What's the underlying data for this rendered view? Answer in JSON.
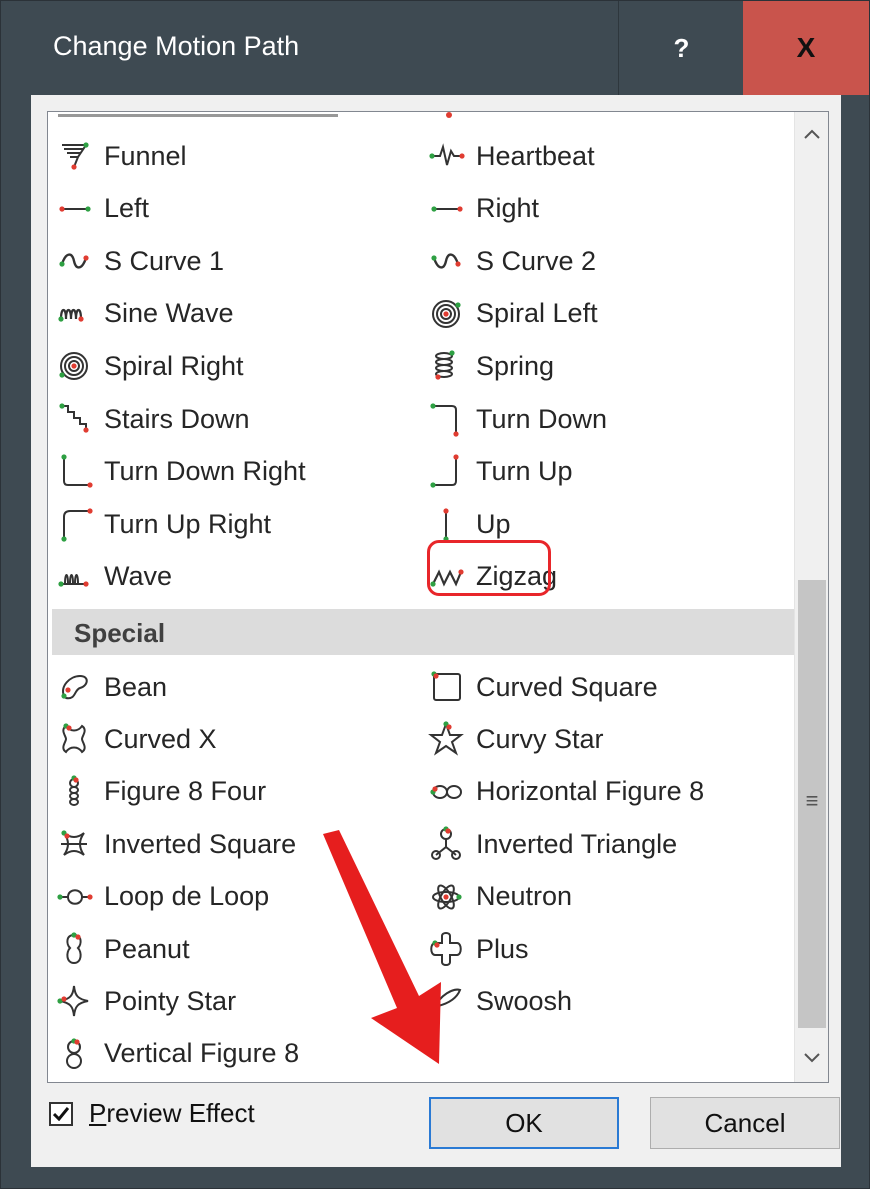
{
  "dialog": {
    "title": "Change Motion Path",
    "help_label": "?",
    "close_label": "X"
  },
  "list": {
    "column_left": [
      {
        "label": "Funnel",
        "icon": "funnel-icon"
      },
      {
        "label": "Left",
        "icon": "line-left-icon"
      },
      {
        "label": "S Curve 1",
        "icon": "s-curve-1-icon"
      },
      {
        "label": "Sine Wave",
        "icon": "sine-wave-icon"
      },
      {
        "label": "Spiral Right",
        "icon": "spiral-right-icon"
      },
      {
        "label": "Stairs Down",
        "icon": "stairs-down-icon"
      },
      {
        "label": "Turn Down Right",
        "icon": "turn-down-right-icon"
      },
      {
        "label": "Turn Up Right",
        "icon": "turn-up-right-icon"
      },
      {
        "label": "Wave",
        "icon": "wave-icon"
      }
    ],
    "column_right": [
      {
        "label": "Heartbeat",
        "icon": "heartbeat-icon"
      },
      {
        "label": "Right",
        "icon": "line-right-icon"
      },
      {
        "label": "S Curve 2",
        "icon": "s-curve-2-icon"
      },
      {
        "label": "Spiral Left",
        "icon": "spiral-left-icon"
      },
      {
        "label": "Spring",
        "icon": "spring-icon"
      },
      {
        "label": "Turn Down",
        "icon": "turn-down-icon"
      },
      {
        "label": "Turn Up",
        "icon": "turn-up-icon"
      },
      {
        "label": "Up",
        "icon": "line-up-icon"
      },
      {
        "label": "Zigzag",
        "icon": "zigzag-icon"
      }
    ],
    "special_header": "Special",
    "special_left": [
      {
        "label": "Bean",
        "icon": "bean-icon"
      },
      {
        "label": "Curved X",
        "icon": "curved-x-icon"
      },
      {
        "label": "Figure 8 Four",
        "icon": "figure-8-four-icon"
      },
      {
        "label": "Inverted Square",
        "icon": "inverted-square-icon"
      },
      {
        "label": "Loop de Loop",
        "icon": "loop-de-loop-icon"
      },
      {
        "label": "Peanut",
        "icon": "peanut-icon"
      },
      {
        "label": "Pointy Star",
        "icon": "pointy-star-icon"
      },
      {
        "label": "Vertical Figure 8",
        "icon": "vertical-figure-8-icon"
      }
    ],
    "special_right": [
      {
        "label": "Curved Square",
        "icon": "curved-square-icon"
      },
      {
        "label": "Curvy Star",
        "icon": "curvy-star-icon"
      },
      {
        "label": "Horizontal Figure 8",
        "icon": "horizontal-figure-8-icon"
      },
      {
        "label": "Inverted Triangle",
        "icon": "inverted-triangle-icon"
      },
      {
        "label": "Neutron",
        "icon": "neutron-icon"
      },
      {
        "label": "Plus",
        "icon": "plus-icon"
      },
      {
        "label": "Swoosh",
        "icon": "swoosh-icon"
      }
    ]
  },
  "footer": {
    "preview_label": "Preview Effect",
    "preview_checked": true,
    "ok_label": "OK",
    "cancel_label": "Cancel"
  },
  "colors": {
    "title_bar": "#3e4a52",
    "close_button": "#c9544c",
    "highlight": "#e8262a",
    "start_marker": "#2ea043",
    "end_marker": "#e03c31"
  }
}
